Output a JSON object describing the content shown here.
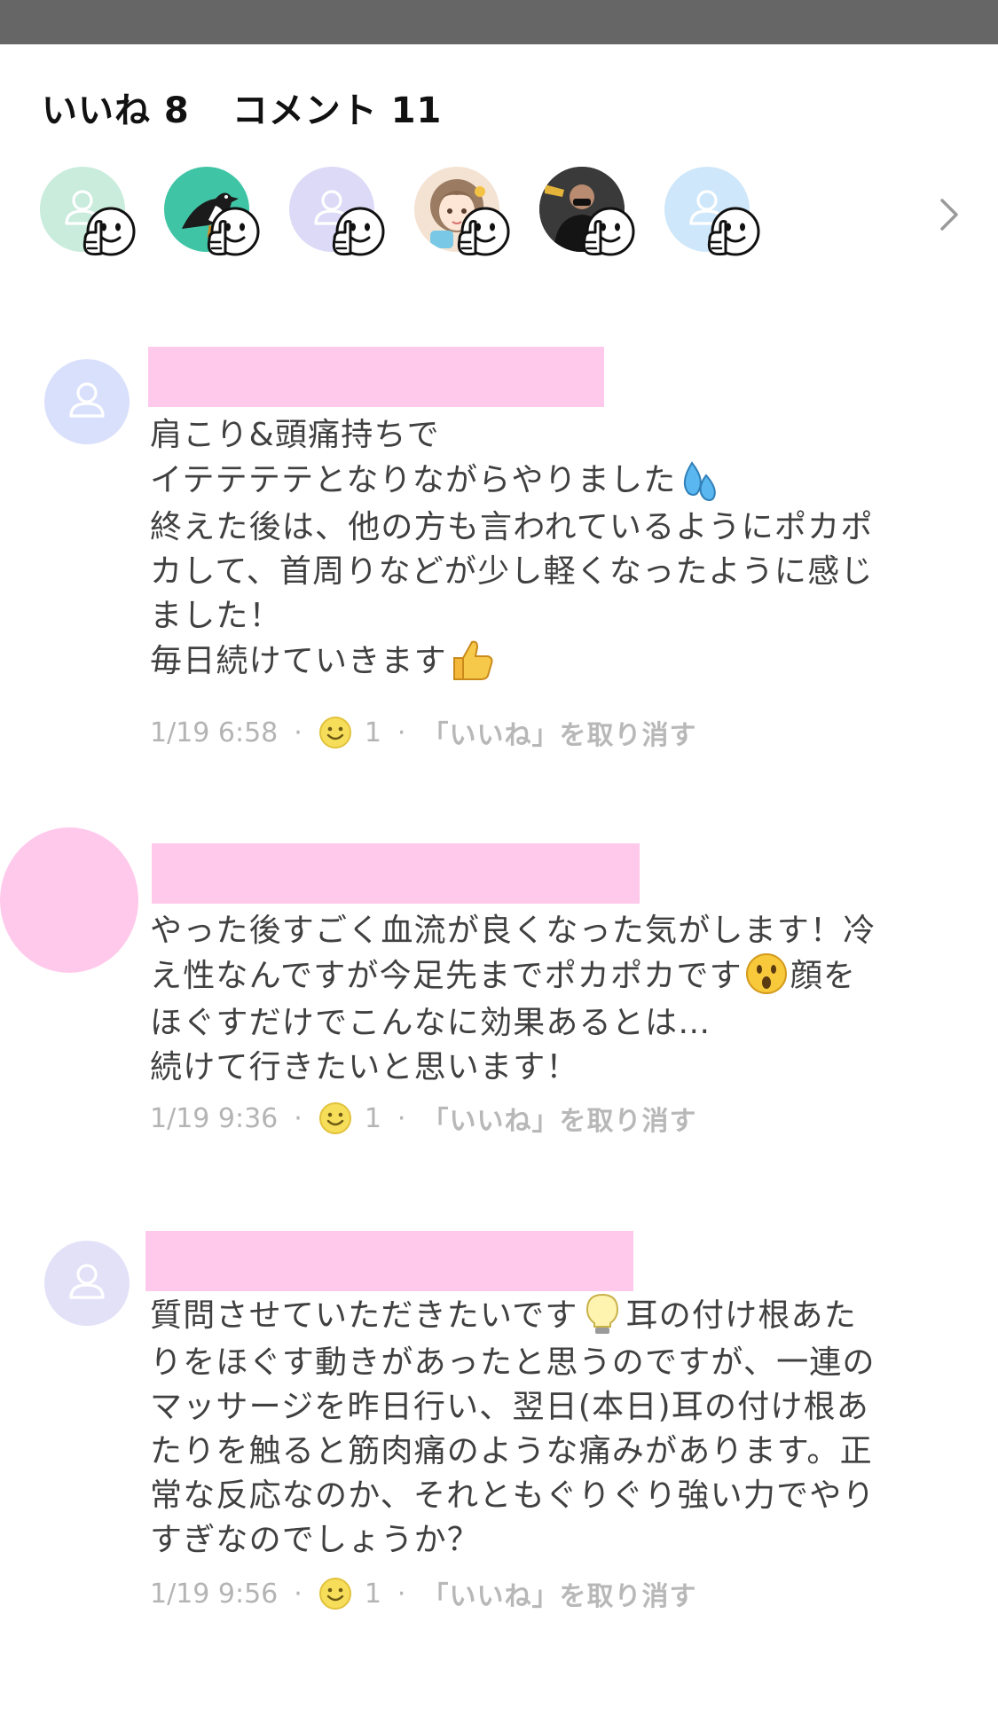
{
  "status_bar": {},
  "header": {
    "likes_label": "いいね 8",
    "comments_label": "コメント 11"
  },
  "likers": [
    {
      "kind": "placeholder",
      "color": "#c9ecdc"
    },
    {
      "kind": "bird",
      "color": "#3fc4a6"
    },
    {
      "kind": "placeholder",
      "color": "#dcdaf7"
    },
    {
      "kind": "illustration",
      "color": "#f4e2d2"
    },
    {
      "kind": "photo",
      "color": "#2b2b2b"
    },
    {
      "kind": "placeholder",
      "color": "#cfe7fa"
    }
  ],
  "comments": [
    {
      "avatar_color": "#d9e0fb",
      "lines": [
        "肩こり&頭痛持ちで",
        "イテテテテとなりながらやりました",
        "終えた後は、他の方も言われているようにポカポ",
        "カして、首周りなどが少し軽くなったように感じ",
        "ました！",
        "毎日続けていきます"
      ],
      "time": "1/19 6:58",
      "like_count": "1",
      "action": "「いいね」を取り消す"
    },
    {
      "avatar_color": "#ffc9eb",
      "lines": [
        "やった後すごく血流が良くなった気がします！冷",
        "え性なんですが今足先までポカポカです",
        "顔を",
        "ほぐすだけでこんなに効果あるとは…",
        "続けて行きたいと思います！"
      ],
      "time": "1/19 9:36",
      "like_count": "1",
      "action": "「いいね」を取り消す"
    },
    {
      "avatar_color": "#e3e1f8",
      "lines": [
        "質問させていただきたいです",
        "耳の付け根あた",
        "りをほぐす動きがあったと思うのですが、一連の",
        "マッサージを昨日行い、翌日(本日)耳の付け根あ",
        "たりを触ると筋肉痛のような痛みがあります。正",
        "常な反応なのか、それともぐりぐり強い力でやり",
        "すぎなのでしょうか？"
      ],
      "time": "1/19 9:56",
      "like_count": "1",
      "action": "「いいね」を取り消す"
    }
  ],
  "colors": {
    "redaction": "#ffc9eb",
    "meta_text": "#b4b4b4",
    "body_text": "#404040",
    "smile_yellow": "#f7de5a"
  }
}
